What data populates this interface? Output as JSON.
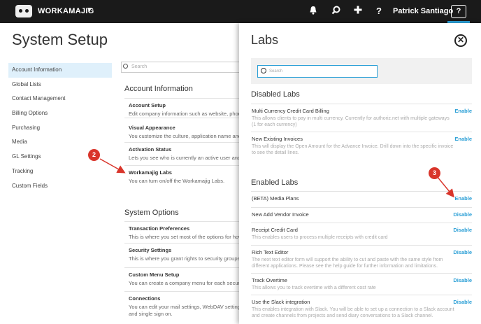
{
  "topbar": {
    "brand": "WORKAMAJIG",
    "icons": [
      "bell-icon",
      "search-icon",
      "plus-icon",
      "question-icon"
    ],
    "user": "Patrick Santiago",
    "help_label": "?"
  },
  "left": {
    "title": "System Setup",
    "search_placeholder": "Search",
    "nav": [
      "Account Information",
      "Global Lists",
      "Contact Management",
      "Billing Options",
      "Purchasing",
      "Media",
      "GL Settings",
      "Tracking",
      "Custom Fields"
    ],
    "account_heading": "Account Information",
    "account_items": [
      {
        "title": "Account Setup",
        "desc": "Edit company information such as website, phone"
      },
      {
        "title": "Visual Appearance",
        "desc": "You customize the culture, application name and"
      },
      {
        "title": "Activation Status",
        "desc": "Lets you see who is currently an active user and w"
      },
      {
        "title": "Workamajig Labs",
        "desc": "You can turn on/off the Workamajig Labs."
      }
    ],
    "system_heading": "System Options",
    "system_items": [
      {
        "title": "Transaction Preferences",
        "desc": "This is where you set most of the options for how"
      },
      {
        "title": "Security Settings",
        "desc": "This is where you grant rights to security groups a"
      },
      {
        "title": "Custom Menu Setup",
        "desc": "You can create a company menu for each security"
      },
      {
        "title": "Connections",
        "desc": "You can edit your mail settings, WebDAV settings",
        "desc2": "and single sign on."
      }
    ]
  },
  "annotations": {
    "badge2": "2",
    "badge3": "3"
  },
  "labs": {
    "title": "Labs",
    "search_placeholder": "Search",
    "disabled_heading": "Disabled Labs",
    "disabled": [
      {
        "name": "Multi Currency Credit Card Billing",
        "action": "Enable",
        "desc": "This allows clients to pay in multi currency. Currently for authoriz.net with multiple gateways (1 for each currency)"
      },
      {
        "name": "New Existing Invoices",
        "action": "Enable",
        "desc": "This will display the Open Amount for the Advance Invoice. Drill down into the specific invoice to see the detail lines."
      }
    ],
    "enabled_heading": "Enabled Labs",
    "enabled": [
      {
        "name": "(BETA) Media Plans",
        "action": "Enable",
        "desc": ""
      },
      {
        "name": "New Add Vendor Invoice",
        "action": "Disable",
        "desc": ""
      },
      {
        "name": "Receipt Credit Card",
        "action": "Disable",
        "desc": "This enables users to process multiple receipts with credit card"
      },
      {
        "name": "Rich Text Editor",
        "action": "Disable",
        "desc": "The next text editor form will support the ability to cut and paste with the same style from different applications. Please see the help guide for further information and limitations."
      },
      {
        "name": "Track Overtime",
        "action": "Disable",
        "desc": "This allows you to track overtime with a different cost rate"
      },
      {
        "name": "Use the Slack integration",
        "action": "Disable",
        "desc": "This enables integration with Slack. You will be able to set up a connection to a Slack account and create channels from projects and send diary conversations to a Slack channel."
      }
    ]
  }
}
